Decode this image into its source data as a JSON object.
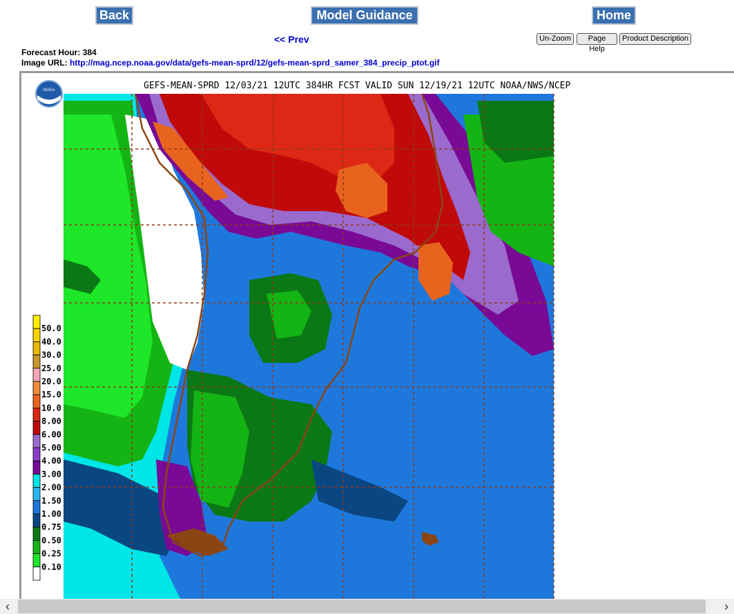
{
  "nav": {
    "back_label": "Back",
    "model_guidance_label": "Model Guidance",
    "home_label": "Home",
    "prev_label": "<< Prev"
  },
  "toolbar": {
    "unzoom_label": "Un-Zoom",
    "page_help_label": "Page Help",
    "product_description_label": "Product Description"
  },
  "info": {
    "forecast_hour_label": "Forecast Hour:",
    "forecast_hour_value": "384",
    "image_url_label": "Image URL:",
    "image_url_value": "http://mag.ncep.noaa.gov/data/gefs-mean-sprd/12/gefs-mean-sprd_samer_384_precip_ptot.gif"
  },
  "map": {
    "title": "GEFS-MEAN-SPRD 12/03/21 12UTC 384HR FCST VALID SUN 12/19/21 12UTC NOAA/NWS/NCEP",
    "logo_text": "NOAA",
    "legend": [
      {
        "label": "50.0",
        "color": "#ffee00"
      },
      {
        "label": "40.0",
        "color": "#f5d300"
      },
      {
        "label": "30.0",
        "color": "#e8b800"
      },
      {
        "label": "25.0",
        "color": "#c8962c"
      },
      {
        "label": "20.0",
        "color": "#f3a6b4"
      },
      {
        "label": "15.0",
        "color": "#f08c3c"
      },
      {
        "label": "10.0",
        "color": "#e8641e"
      },
      {
        "label": "8.00",
        "color": "#dc2814"
      },
      {
        "label": "6.00",
        "color": "#c00a0a"
      },
      {
        "label": "5.00",
        "color": "#9a6acc"
      },
      {
        "label": "4.00",
        "color": "#8a3ccc"
      },
      {
        "label": "3.00",
        "color": "#780a96"
      },
      {
        "label": "2.00",
        "color": "#00e6e6"
      },
      {
        "label": "1.50",
        "color": "#28b4f0"
      },
      {
        "label": "1.00",
        "color": "#1e78dc"
      },
      {
        "label": "0.75",
        "color": "#0a4682"
      },
      {
        "label": "0.50",
        "color": "#0a7814"
      },
      {
        "label": "0.25",
        "color": "#14b414"
      },
      {
        "label": "0.10",
        "color": "#1ee628"
      },
      {
        "label": "",
        "color": "#ffffff"
      }
    ]
  },
  "scrollbar": {
    "left_arrow": "‹",
    "right_arrow": "›"
  }
}
